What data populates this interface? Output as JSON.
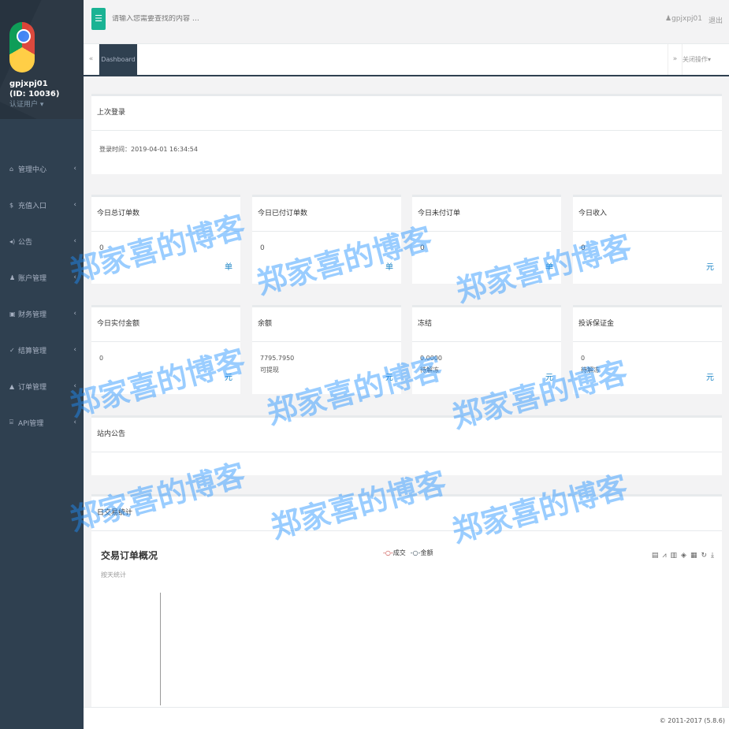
{
  "user": {
    "name": "gpjxpj01",
    "id": "(ID: 10036)",
    "role": "认证用户 ▾"
  },
  "nav": [
    {
      "label": "管理中心",
      "icon": "home-icon",
      "glyph": "⌂"
    },
    {
      "label": "充值入口",
      "icon": "dollar-icon",
      "glyph": "$"
    },
    {
      "label": "公告",
      "icon": "volume-icon",
      "glyph": "◂)"
    },
    {
      "label": "账户管理",
      "icon": "user-icon",
      "glyph": "♟"
    },
    {
      "label": "财务管理",
      "icon": "money-icon",
      "glyph": "▣"
    },
    {
      "label": "结算管理",
      "icon": "check-icon",
      "glyph": "✓"
    },
    {
      "label": "订单管理",
      "icon": "cart-icon",
      "glyph": "▲"
    },
    {
      "label": "API管理",
      "icon": "bank-icon",
      "glyph": "⌸"
    }
  ],
  "topbar": {
    "menu_glyph": "☰",
    "search_placeholder": "请输入您需要查找的内容 …",
    "user": "gpjxpj01",
    "logout": "退出"
  },
  "tabs": {
    "prev": "«",
    "active": "Dashboard",
    "next": "»",
    "close": "关闭操作▾"
  },
  "login": {
    "title": "上次登录",
    "time": "登录时间：2019-04-01 16:34:54"
  },
  "stats_row1": [
    {
      "title": "今日总订单数",
      "value": "0",
      "unit": "单"
    },
    {
      "title": "今日已付订单数",
      "value": "0",
      "unit": "单"
    },
    {
      "title": "今日未付订单",
      "value": "0",
      "unit": "单"
    },
    {
      "title": "今日收入",
      "value": "0",
      "unit": "元"
    }
  ],
  "stats_row2": [
    {
      "title": "今日实付金额",
      "value": "0",
      "sub": "",
      "unit": "元"
    },
    {
      "title": "余额",
      "value": "7795.7950",
      "sub": "可提现",
      "unit": "元"
    },
    {
      "title": "冻结",
      "value": "0.0000",
      "sub": "待解冻",
      "unit": "元"
    },
    {
      "title": "投诉保证金",
      "value": "0",
      "sub": "待解冻",
      "unit": "元"
    }
  ],
  "notice": {
    "title": "站内公告"
  },
  "chart": {
    "box_title": "日交易统计",
    "title": "交易订单概况",
    "subtitle": "按天统计",
    "legend": [
      "成交",
      "金额"
    ],
    "legend_colors": [
      "#c23531",
      "#2f4554"
    ]
  },
  "footer": "© 2011-2017 (5.8.6)",
  "watermark": "郑家喜的博客",
  "colors": {
    "sidebar": "#2f4050",
    "accent": "#1ab394",
    "unit": "#1c84c6"
  }
}
